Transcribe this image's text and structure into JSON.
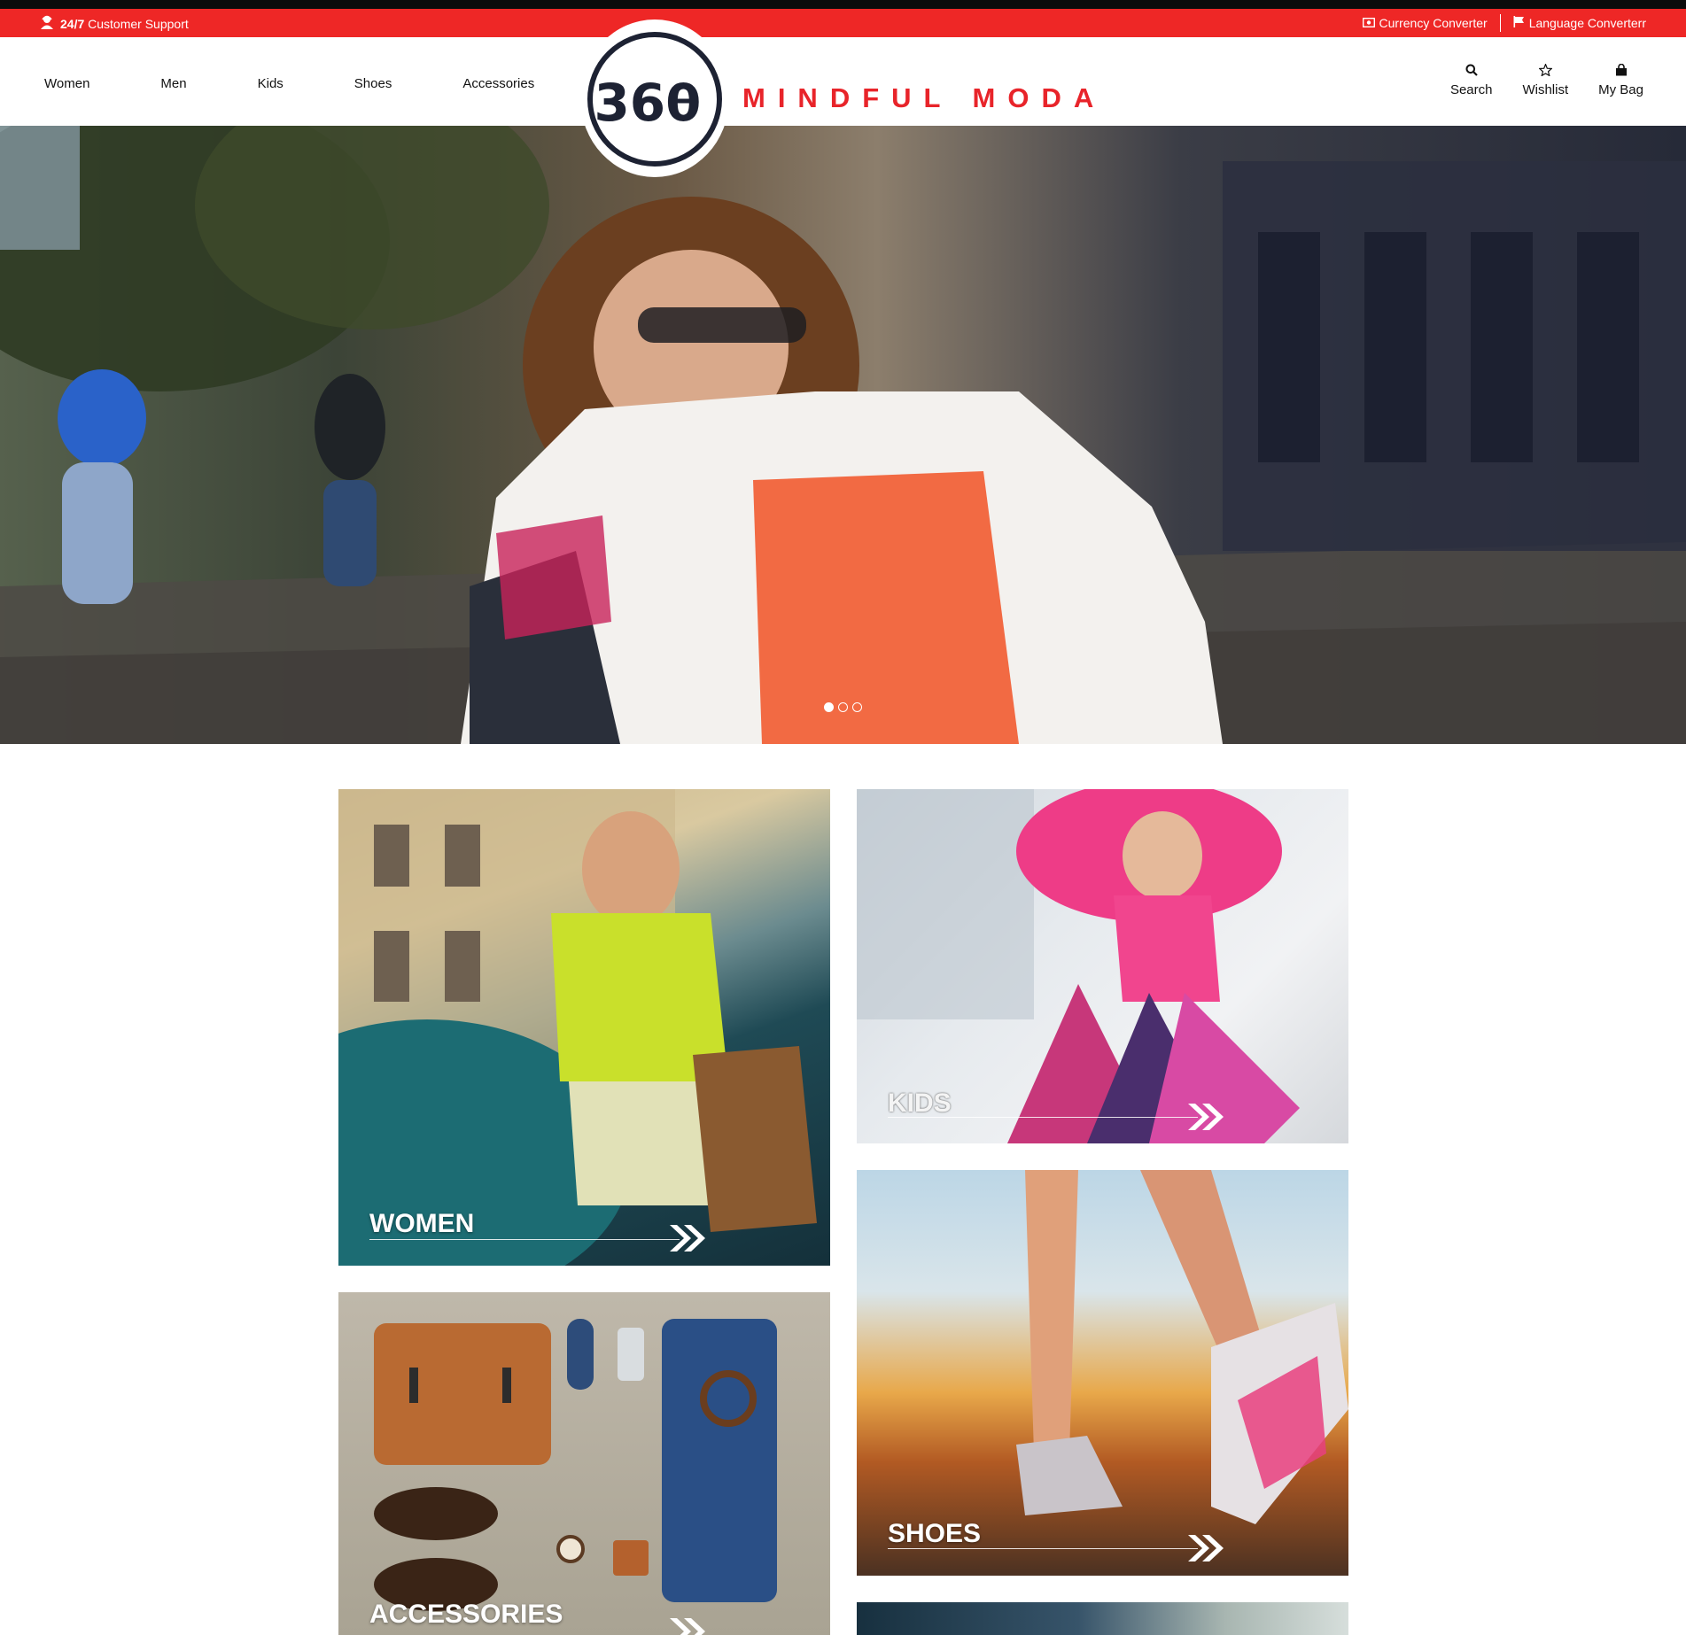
{
  "topbar": {
    "support_label": "Customer Support",
    "support_prefix": "24/7",
    "currency_label": "Currency Converter",
    "language_label": "Language Converterr"
  },
  "nav": {
    "items": [
      "Women",
      "Men",
      "Kids",
      "Shoes",
      "Accessories"
    ]
  },
  "brand": {
    "logo_text": "360",
    "name": "MINDFUL MODA"
  },
  "tools": {
    "search_label": "Search",
    "wishlist_label": "Wishlist",
    "bag_label": "My Bag"
  },
  "hero": {
    "slide_count": 3,
    "active_slide": 1
  },
  "tiles": {
    "women": "WOMEN",
    "kids": "KIDS",
    "shoes": "SHOES",
    "accessories": "ACCESSORIES"
  },
  "colors": {
    "accent": "#ee2726",
    "brand_text": "#e8242a",
    "logo_ring": "#1d2233"
  },
  "icons": [
    "user-headset-icon",
    "money-icon",
    "flag-icon",
    "search-icon",
    "star-icon",
    "bag-icon",
    "double-chevron-right-icon"
  ]
}
